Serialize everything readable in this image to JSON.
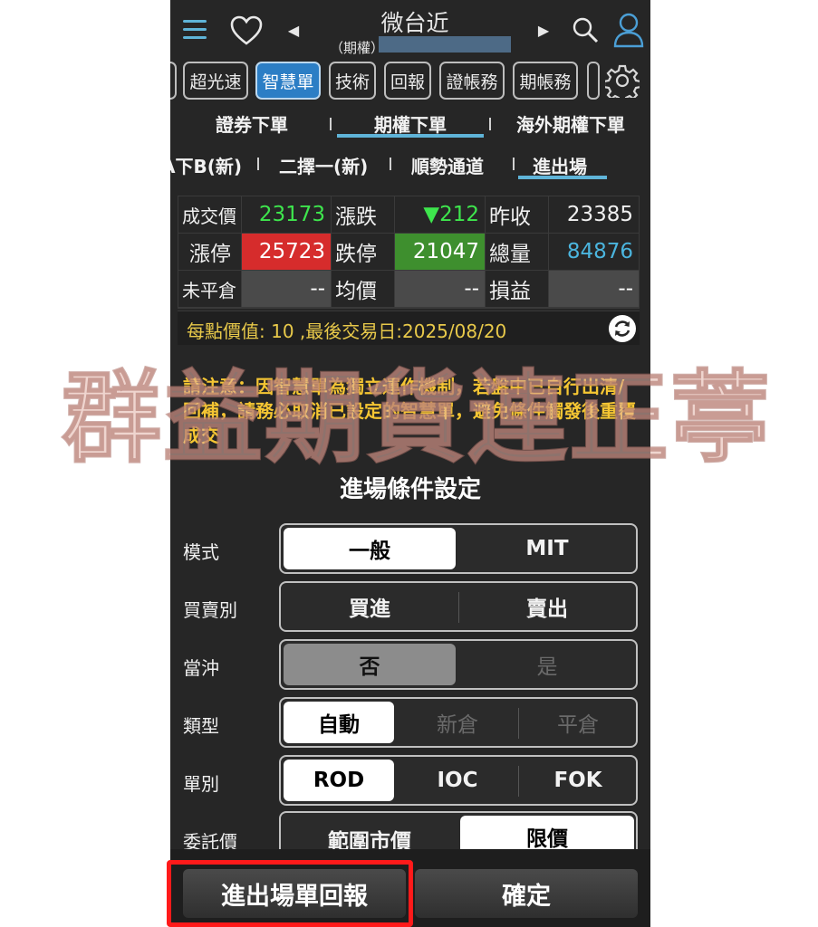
{
  "header": {
    "title": "微台近",
    "subtitle": "（期權）",
    "icons": [
      "menu-icon",
      "heart-icon",
      "prev-icon",
      "next-icon",
      "search-icon",
      "user-icon"
    ]
  },
  "tabs": [
    {
      "label": "超光速",
      "active": false
    },
    {
      "label": "智慧單",
      "active": true
    },
    {
      "label": "技術",
      "active": false
    },
    {
      "label": "回報",
      "active": false
    },
    {
      "label": "證帳務",
      "active": false
    },
    {
      "label": "期帳務",
      "active": false
    }
  ],
  "order_tabs": [
    {
      "label": "證券下單",
      "active": false
    },
    {
      "label": "期權下單",
      "active": true
    },
    {
      "label": "海外期權下單",
      "active": false
    }
  ],
  "sub_tabs": [
    {
      "label": "A下B(新)",
      "active": false
    },
    {
      "label": "二擇一(新)",
      "active": false
    },
    {
      "label": "順勢通道",
      "active": false
    },
    {
      "label": "進出場",
      "active": true
    }
  ],
  "quote": {
    "last_label": "成交價",
    "last_value": "23173",
    "change_label": "漲跌",
    "change_value": "▼212",
    "prev_close_label": "昨收",
    "prev_close_value": "23385",
    "limit_up_label": "漲停",
    "limit_up_value": "25723",
    "limit_down_label": "跌停",
    "limit_down_value": "21047",
    "volume_label": "總量",
    "volume_value": "84876",
    "open_pos_label": "未平倉",
    "open_pos_value": "--",
    "avg_price_label": "均價",
    "avg_price_value": "--",
    "pnl_label": "損益",
    "pnl_value": "--"
  },
  "info": {
    "text": "每點價值: 10 ,最後交易日:2025/08/20"
  },
  "notice": "請注意：因智慧單為獨立運作機制，若盤中已自行出清/回補，請務必取消已設定的智慧單，避免條件觸發後重覆成交",
  "section_title": "進場條件設定",
  "form": {
    "mode": {
      "label": "模式",
      "options": [
        "一般",
        "MIT"
      ],
      "selected": 0
    },
    "side": {
      "label": "買賣別",
      "options": [
        "買進",
        "賣出"
      ]
    },
    "daytrade": {
      "label": "當沖",
      "options": [
        "否",
        "是"
      ],
      "selected": 0
    },
    "kind": {
      "label": "類型",
      "options": [
        "自動",
        "新倉",
        "平倉"
      ],
      "selected": 0
    },
    "order_type": {
      "label": "單別",
      "options": [
        "ROD",
        "IOC",
        "FOK"
      ],
      "selected": 0
    },
    "price": {
      "label": "委託價",
      "options": [
        "範圍市價",
        "限價"
      ],
      "selected": 1
    }
  },
  "buttons": {
    "report": "進出場單回報",
    "confirm": "確定"
  },
  "watermark": "群益期貨連正葶",
  "colors": {
    "accent_blue": "#2c7ec5",
    "up_red": "#d62c2c",
    "down_green": "#3e8f2e",
    "price_green": "#3ee64d",
    "volume_blue": "#4bb5de",
    "notice_yellow": "#f5c633",
    "highlight_red": "#ff1a1a"
  }
}
